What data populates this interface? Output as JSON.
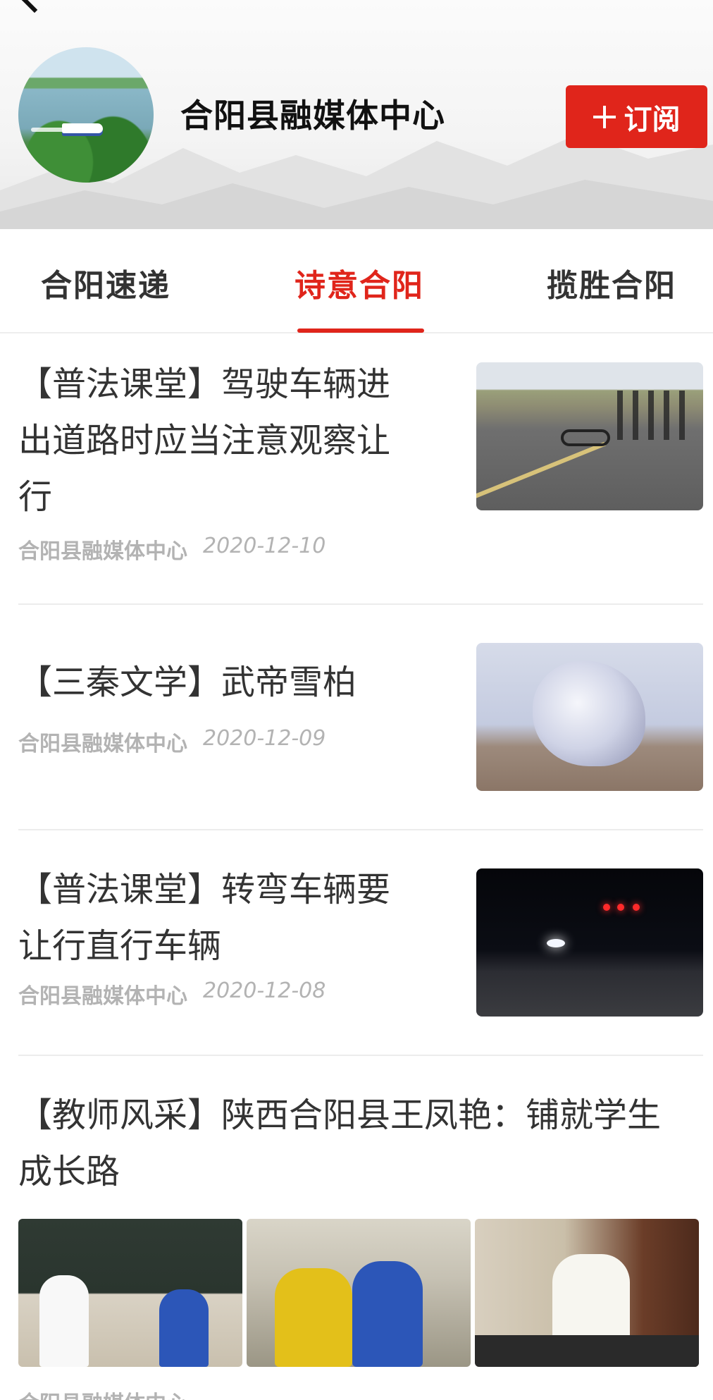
{
  "header": {
    "org_name": "合阳县融媒体中心",
    "subscribe_label": "订阅",
    "accent_color": "#e0251b"
  },
  "tabs": [
    {
      "label": "合阳速递",
      "active": false
    },
    {
      "label": "诗意合阳",
      "active": true
    },
    {
      "label": "揽胜合阳",
      "active": false
    }
  ],
  "articles": [
    {
      "title_lines": [
        "【普法课堂】驾驶车辆进",
        "出道路时应当注意观察让",
        "行"
      ],
      "source": "合阳县融媒体中心",
      "date": "2020-12-10",
      "thumbnail": "road-accident-photo"
    },
    {
      "title_lines": [
        "【三秦文学】武帝雪柏"
      ],
      "source": "合阳县融媒体中心",
      "date": "2020-12-09",
      "thumbnail": "snow-tree-photo"
    },
    {
      "title_lines": [
        "【普法课堂】转弯车辆要",
        "让行直行车辆"
      ],
      "source": "合阳县融媒体中心",
      "date": "2020-12-08",
      "thumbnail": "night-intersection-photo"
    },
    {
      "title_lines": [
        "【教师风采】陕西合阳县王凤艳：铺就学生",
        "成长路"
      ],
      "source": "合阳县融媒体中心",
      "thumbnails": [
        "classroom-photo-1",
        "classroom-photo-2",
        "classroom-photo-3"
      ]
    }
  ]
}
